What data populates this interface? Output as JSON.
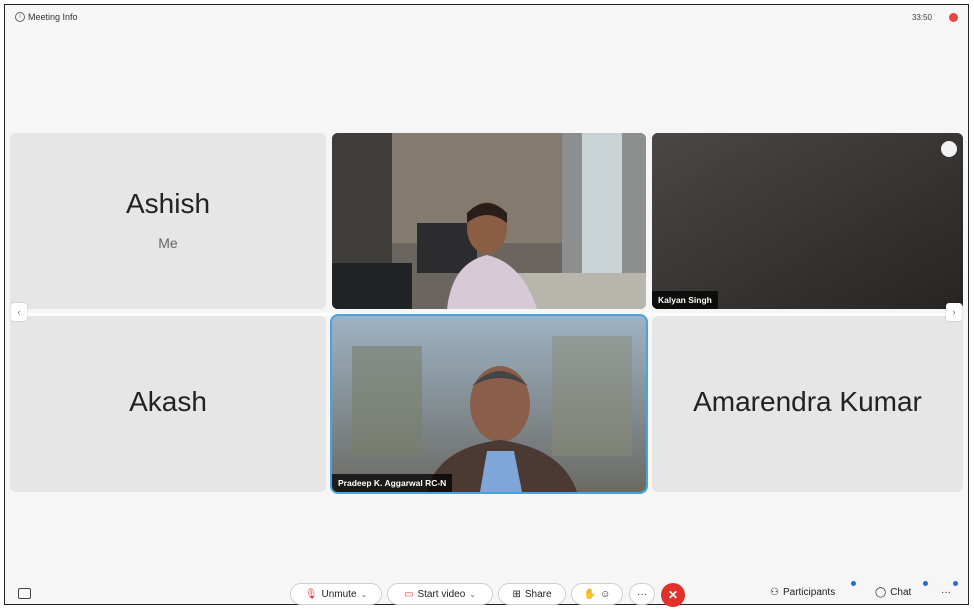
{
  "topbar": {
    "meeting_info": "Meeting Info",
    "timer": "33:50"
  },
  "participants": {
    "ashish": {
      "name": "Ashish",
      "sub": "Me"
    },
    "akash": {
      "name": "Akash"
    },
    "amarendra": {
      "name": "Amarendra Kumar"
    },
    "kalyan": {
      "name": "Kalyan Singh"
    },
    "pradeep": {
      "name": "Pradeep K. Aggarwal RC-N"
    }
  },
  "controls": {
    "unmute": "Unmute",
    "start_video": "Start video",
    "share": "Share",
    "more": "···",
    "participants": "Participants",
    "chat": "Chat",
    "overflow": "···"
  },
  "colors": {
    "accent_blue": "#4aa3e0",
    "leave_red": "#e0312b",
    "mute_red": "#e03b36"
  }
}
